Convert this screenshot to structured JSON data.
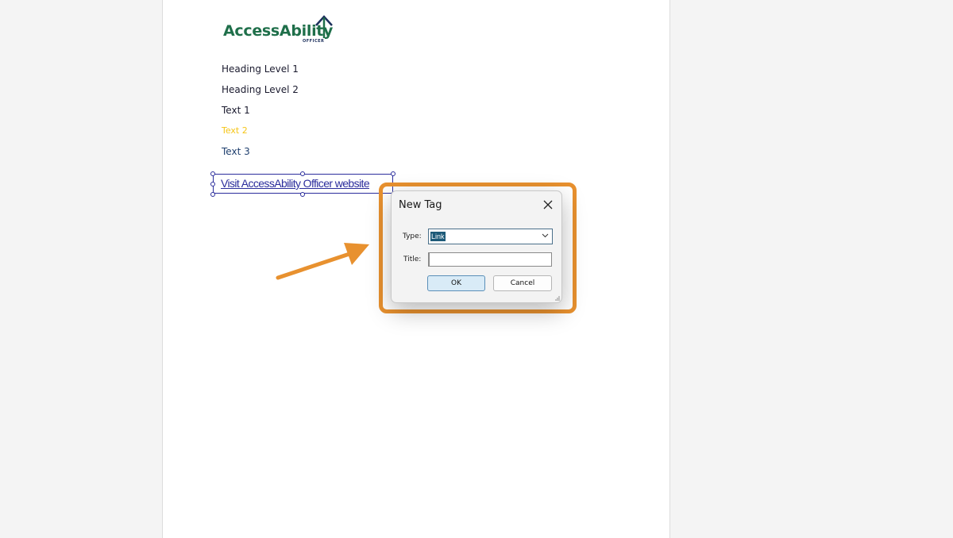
{
  "logo": {
    "text": "AccessAbility",
    "subtext": "OFFICER"
  },
  "document": {
    "lines": [
      {
        "text": "Heading Level 1",
        "color": "#1a1a2e"
      },
      {
        "text": "Heading Level 2",
        "color": "#1a1a2e"
      },
      {
        "text": "Text 1",
        "color": "#1a1a2e"
      },
      {
        "text": "Text 2",
        "color": "#f5c518"
      },
      {
        "text": "Text 3",
        "color": "#1f3f6e"
      }
    ],
    "link_text": "Visit AccessAbility Officer website"
  },
  "dialog": {
    "title": "New Tag",
    "type_label": "Type:",
    "type_value": "Link",
    "title_label": "Title:",
    "title_value": "",
    "ok_label": "OK",
    "cancel_label": "Cancel"
  },
  "colors": {
    "highlight": "#e8912f",
    "link": "#2b2d9c",
    "logo_green": "#1f6f4a",
    "logo_navy": "#1c2f5c"
  }
}
